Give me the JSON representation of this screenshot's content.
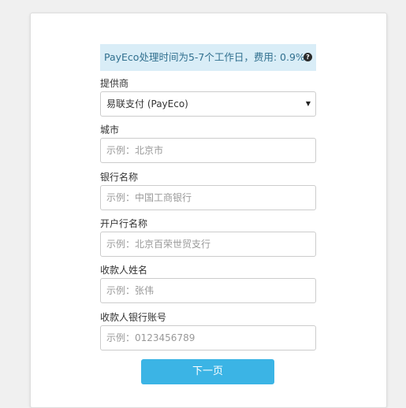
{
  "banner": {
    "text": "PayEco处理时间为5-7个工作日，费用: 0.9%",
    "help_icon": "help-icon"
  },
  "form": {
    "provider": {
      "label": "提供商",
      "value": "易联支付 (PayEco)"
    },
    "city": {
      "label": "城市",
      "placeholder": "示例：北京市"
    },
    "bank_name": {
      "label": "银行名称",
      "placeholder": "示例：中国工商银行"
    },
    "branch_name": {
      "label": "开户行名称",
      "placeholder": "示例：北京百荣世贸支行"
    },
    "payee_name": {
      "label": "收款人姓名",
      "placeholder": "示例：张伟"
    },
    "payee_account": {
      "label": "收款人银行账号",
      "placeholder": "示例：0123456789"
    }
  },
  "actions": {
    "next_label": "下一页"
  },
  "colors": {
    "banner_bg": "#d9edf7",
    "banner_text": "#31708f",
    "button_bg": "#3bb4e5"
  }
}
